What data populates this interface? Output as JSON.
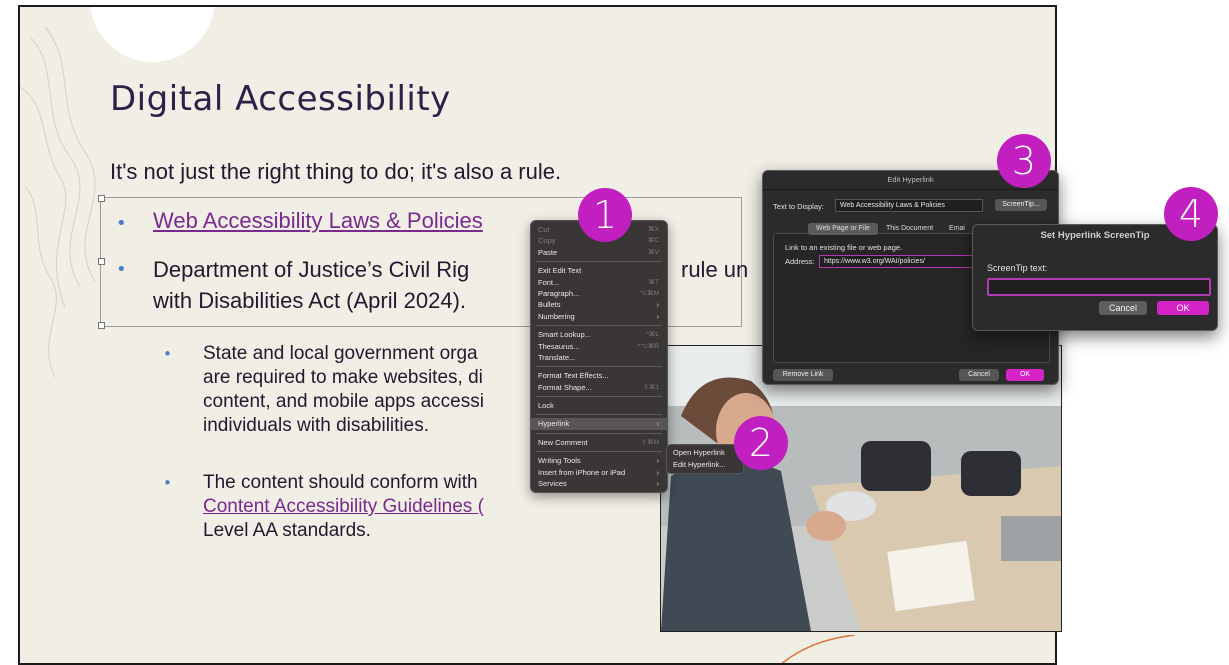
{
  "slide": {
    "title": "Digital Accessibility",
    "subtitle": "It's not just the right thing to do; it's also a rule.",
    "bullet1_link": "Web Accessibility Laws & Policies",
    "bullet2_line1": "Department of Justice’s Civil Rig",
    "bullet2_tail": "rule un",
    "bullet2_line2": "with Disabilities Act (April 2024).",
    "sub1": "State and local government orga are required to make websites, di content, and mobile apps accessi individuals with disabilities.",
    "sub1_lines": [
      "State and local government orga",
      "are required to make websites, di",
      "content, and mobile apps accessi",
      "individuals with disabilities."
    ],
    "sub2_line1": "The content should conform with",
    "sub2_link": "Content Accessibility Guidelines (",
    "sub2_line3": "Level AA standards."
  },
  "context_menu": {
    "items": [
      {
        "label": "Cut",
        "shortcut": "⌘X",
        "disabled": true
      },
      {
        "label": "Copy",
        "shortcut": "⌘C",
        "disabled": true
      },
      {
        "label": "Paste",
        "shortcut": "⌘V",
        "disabled": false
      },
      {
        "sep": true
      },
      {
        "label": "Exit Edit Text",
        "shortcut": "",
        "disabled": false
      },
      {
        "label": "Font...",
        "shortcut": "⌘T",
        "disabled": false
      },
      {
        "label": "Paragraph...",
        "shortcut": "⌥⌘M",
        "disabled": false
      },
      {
        "label": "Bullets",
        "submenu": true
      },
      {
        "label": "Numbering",
        "submenu": true
      },
      {
        "sep": true
      },
      {
        "label": "Smart Lookup...",
        "shortcut": "^⌘L",
        "disabled": false
      },
      {
        "label": "Thesaurus...",
        "shortcut": "^⌥⌘R",
        "disabled": false
      },
      {
        "label": "Translate...",
        "shortcut": "",
        "disabled": false
      },
      {
        "sep": true
      },
      {
        "label": "Format Text Effects...",
        "shortcut": "",
        "disabled": false
      },
      {
        "label": "Format Shape...",
        "shortcut": "⇧⌘1",
        "disabled": false
      },
      {
        "sep": true
      },
      {
        "label": "Lock",
        "shortcut": "",
        "disabled": false
      },
      {
        "sep": true
      },
      {
        "label": "Hyperlink",
        "submenu": true,
        "highlight": true
      },
      {
        "sep": true
      },
      {
        "label": "New Comment",
        "shortcut": "⇧⌘M",
        "disabled": false
      },
      {
        "sep": true
      },
      {
        "label": "Writing Tools",
        "submenu": true
      },
      {
        "label": "Insert from iPhone or iPad",
        "submenu": true
      },
      {
        "label": "Services",
        "submenu": true
      }
    ]
  },
  "hyperlink_submenu": {
    "items": [
      "Open Hyperlink",
      "Edit Hyperlink..."
    ]
  },
  "edit_hyperlink": {
    "title": "Edit Hyperlink",
    "text_to_display_label": "Text to Display:",
    "text_to_display_value": "Web Accessibility Laws & Policies",
    "screentip_button": "ScreenTip...",
    "tabs": [
      "Web Page or File",
      "This Document",
      "Emai"
    ],
    "hint": "Link to an existing file or web page.",
    "address_label": "Address:",
    "address_value": "https://www.w3.org/WAI/policies/",
    "remove_link": "Remove Link",
    "cancel": "Cancel",
    "ok": "OK"
  },
  "screentip_dialog": {
    "title": "Set Hyperlink ScreenTip",
    "label": "ScreenTip text:",
    "value": "",
    "cancel": "Cancel",
    "ok": "OK"
  },
  "badges": [
    "1",
    "2",
    "3",
    "4"
  ],
  "colors": {
    "accent": "#c21fc0",
    "link": "#7a2a8f",
    "title": "#2c2148",
    "bullet": "#4a7ec7"
  }
}
